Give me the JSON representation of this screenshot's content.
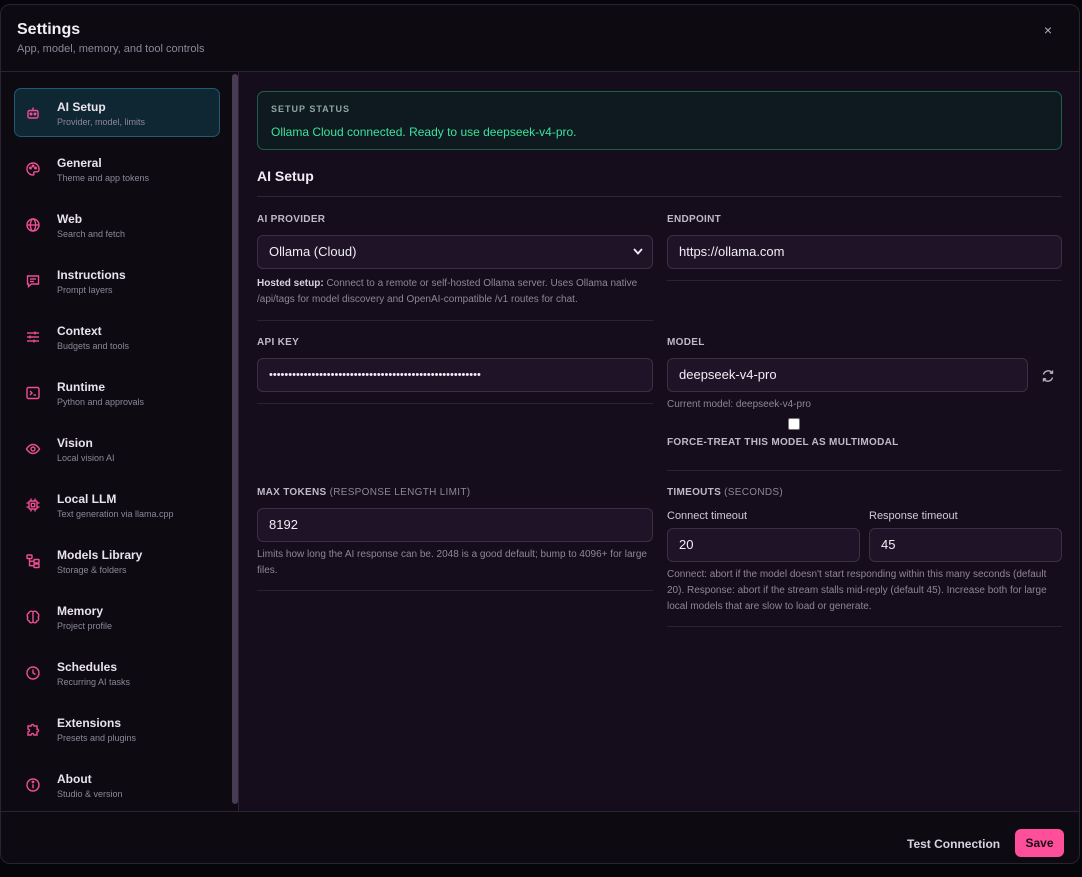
{
  "header": {
    "title": "Settings",
    "subtitle": "App, model, memory, and tool controls",
    "close_label": "×"
  },
  "sidebar": {
    "items": [
      {
        "label": "AI Setup",
        "desc": "Provider, model, limits",
        "icon": "robot-icon",
        "active": true
      },
      {
        "label": "General",
        "desc": "Theme and app tokens",
        "icon": "palette-icon"
      },
      {
        "label": "Web",
        "desc": "Search and fetch",
        "icon": "globe-icon"
      },
      {
        "label": "Instructions",
        "desc": "Prompt layers",
        "icon": "message-icon"
      },
      {
        "label": "Context",
        "desc": "Budgets and tools",
        "icon": "sliders-icon"
      },
      {
        "label": "Runtime",
        "desc": "Python and approvals",
        "icon": "terminal-icon"
      },
      {
        "label": "Vision",
        "desc": "Local vision AI",
        "icon": "eye-icon"
      },
      {
        "label": "Local LLM",
        "desc": "Text generation via llama.cpp",
        "icon": "chip-icon"
      },
      {
        "label": "Models Library",
        "desc": "Storage & folders",
        "icon": "folder-tree-icon"
      },
      {
        "label": "Memory",
        "desc": "Project profile",
        "icon": "brain-icon"
      },
      {
        "label": "Schedules",
        "desc": "Recurring AI tasks",
        "icon": "clock-icon"
      },
      {
        "label": "Extensions",
        "desc": "Presets and plugins",
        "icon": "puzzle-icon"
      },
      {
        "label": "About",
        "desc": "Studio & version",
        "icon": "info-icon"
      }
    ]
  },
  "status": {
    "title": "SETUP STATUS",
    "text": "Ollama Cloud connected. Ready to use deepseek-v4-pro."
  },
  "section": {
    "title": "AI Setup"
  },
  "provider": {
    "label": "AI PROVIDER",
    "value": "Ollama (Cloud)",
    "help_bold": "Hosted setup:",
    "help_text": " Connect to a remote or self-hosted Ollama server. Uses Ollama native /api/tags for model discovery and OpenAI-compatible /v1 routes for chat."
  },
  "endpoint": {
    "label": "ENDPOINT",
    "value": "https://ollama.com"
  },
  "api_key": {
    "label": "API KEY",
    "value": "•••••••••••••••••••••••••••••••••••••••••••••••••••••••"
  },
  "model": {
    "label": "MODEL",
    "value": "deepseek-v4-pro",
    "current": "Current model: deepseek-v4-pro",
    "multimodal_label": "FORCE-TREAT THIS MODEL AS MULTIMODAL"
  },
  "max_tokens": {
    "label": "MAX TOKENS",
    "label_muted": " (RESPONSE LENGTH LIMIT)",
    "value": "8192",
    "help": "Limits how long the AI response can be. 2048 is a good default; bump to 4096+ for large files."
  },
  "timeouts": {
    "label": "TIMEOUTS",
    "label_muted": " (SECONDS)",
    "connect_label": "Connect timeout",
    "connect_value": "20",
    "response_label": "Response timeout",
    "response_value": "45",
    "help": "Connect: abort if the model doesn't start responding within this many seconds (default 20). Response: abort if the stream stalls mid-reply (default 45). Increase both for large local models that are slow to load or generate."
  },
  "footer": {
    "test_label": "Test Connection",
    "save_label": "Save"
  },
  "colors": {
    "accent": "#ff4f9a",
    "status_green": "#39e39b",
    "active_nav": "#0f2733"
  }
}
